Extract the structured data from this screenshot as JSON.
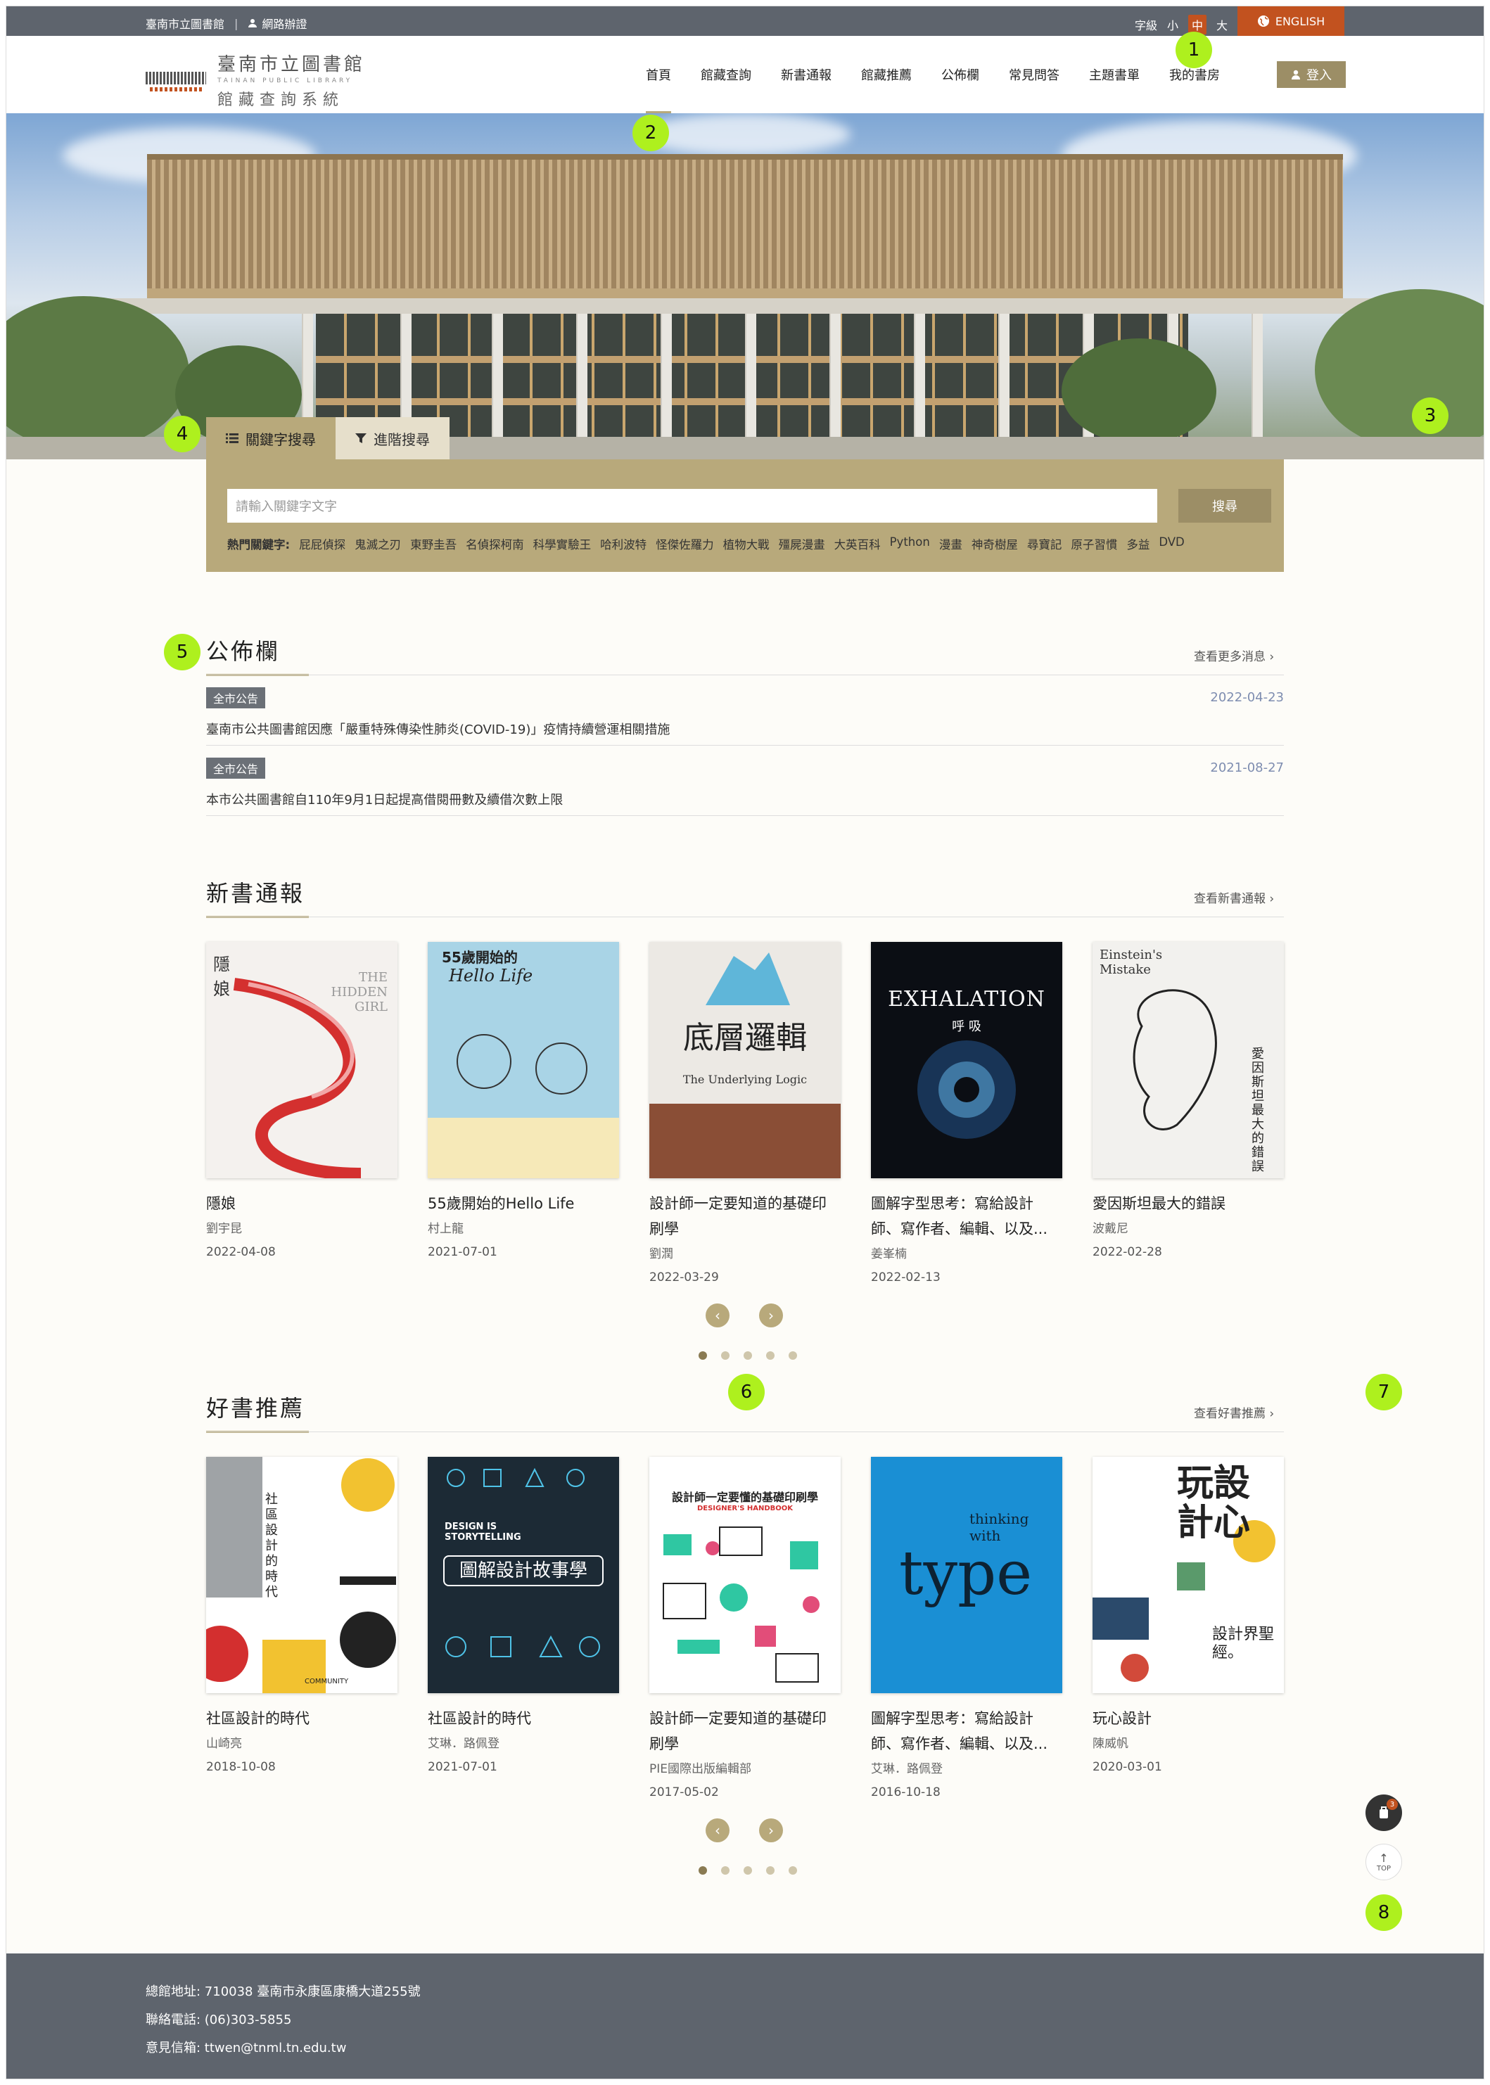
{
  "topbar": {
    "library_name": "臺南市立圖書館",
    "separator": "|",
    "network_label": "網路辦證",
    "font_label": "字級",
    "font_small": "小",
    "font_medium": "中",
    "font_large": "大",
    "english_label": "ENGLISH"
  },
  "header": {
    "logo_zh": "臺南市立圖書館",
    "logo_en": "TAINAN PUBLIC LIBRARY",
    "logo_sub": "館藏查詢系統",
    "nav": [
      "首頁",
      "館藏查詢",
      "新書通報",
      "館藏推薦",
      "公佈欄",
      "常見問答",
      "主題書單",
      "我的書房"
    ],
    "login_label": "登入"
  },
  "search": {
    "tab_keyword": "關鍵字搜尋",
    "tab_advanced": "進階搜尋",
    "placeholder": "請輸入關鍵字文字",
    "button": "搜尋",
    "hot_label": "熱門關鍵字:",
    "hot_keywords": [
      "屁屁偵探",
      "鬼滅之刃",
      "東野圭吾",
      "名偵探柯南",
      "科學實驗王",
      "哈利波特",
      "怪傑佐羅力",
      "植物大戰",
      "殭屍漫畫",
      "大英百科",
      "Python",
      "漫畫",
      "神奇樹屋",
      "尋寶記",
      "原子習慣",
      "多益",
      "DVD"
    ]
  },
  "notices": {
    "title": "公佈欄",
    "more": "查看更多消息",
    "items": [
      {
        "badge": "全市公告",
        "date": "2022-04-23",
        "text": "臺南市公共圖書館因應「嚴重特殊傳染性肺炎(COVID-19)」疫情持續營運相關措施"
      },
      {
        "badge": "全市公告",
        "date": "2021-08-27",
        "text": "本市公共圖書館自110年9月1日起提高借閱冊數及續借次數上限"
      }
    ]
  },
  "new_books": {
    "title": "新書通報",
    "more": "查看新書通報",
    "items": [
      {
        "title": "隱娘",
        "author": "劉宇昆",
        "date": "2022-04-08",
        "cover_text": "隱 娘",
        "cover_sub": "THE HIDDEN GIRL"
      },
      {
        "title": "55歲開始的Hello Life",
        "author": "村上龍",
        "date": "2021-07-01",
        "cover_text": "55歲開始的",
        "cover_sub": "Hello Life"
      },
      {
        "title": "設計師一定要知道的基礎印刷學",
        "author": "劉潤",
        "date": "2022-03-29",
        "cover_text": "底層邏輯",
        "cover_sub": "The Underlying Logic"
      },
      {
        "title": "圖解字型思考：寫給設計師、寫作者、編輯、以及...",
        "author": "姜峯楠",
        "date": "2022-02-13",
        "cover_text": "EXHALATION",
        "cover_sub": "呼 吸"
      },
      {
        "title": "愛因斯坦最大的錯誤",
        "author": "波戴尼",
        "date": "2022-02-28",
        "cover_text": "Einstein's Mistake",
        "cover_sub": "愛因斯坦最大的錯誤"
      }
    ],
    "dots": 5
  },
  "recommend": {
    "title": "好書推薦",
    "more": "查看好書推薦",
    "items": [
      {
        "title": "社區設計的時代",
        "author": "山崎亮",
        "date": "2018-10-08",
        "cover_text": "社區設計的時代",
        "cover_sub": "COMMUNITY"
      },
      {
        "title": "社區設計的時代",
        "author": "艾琳．路佩登",
        "date": "2021-07-01",
        "cover_text": "圖解設計故事學",
        "cover_sub": "DESIGN IS STORYTELLING"
      },
      {
        "title": "設計師一定要知道的基礎印刷學",
        "author": "PIE國際出版編輯部",
        "date": "2017-05-02",
        "cover_text": "設計師一定要懂的基礎印刷學",
        "cover_sub": "DESIGNER'S HANDBOOK"
      },
      {
        "title": "圖解字型思考：寫給設計師、寫作者、編輯、以及...",
        "author": "艾琳．路佩登",
        "date": "2016-10-18",
        "cover_text": "type",
        "cover_sub": "thinking with"
      },
      {
        "title": "玩心設計",
        "author": "陳威帆",
        "date": "2020-03-01",
        "cover_text": "玩設計心",
        "cover_sub": "設計界聖經。"
      }
    ],
    "dots": 5
  },
  "floating": {
    "cart_count": "3",
    "top_label": "TOP"
  },
  "markers": [
    "1",
    "2",
    "3",
    "4",
    "5",
    "6",
    "7",
    "8"
  ],
  "footer": {
    "address": "總館地址: 710038 臺南市永康區康橋大道255號",
    "phone": "聯絡電話: (06)303-5855",
    "email": "意見信箱: ttwen@tnml.tn.edu.tw"
  },
  "colors": {
    "gold": "#b8a97b",
    "dark_gold": "#9c8e66",
    "accent": "#c2521f",
    "bar": "#5e646d",
    "marker": "#aef01e"
  }
}
